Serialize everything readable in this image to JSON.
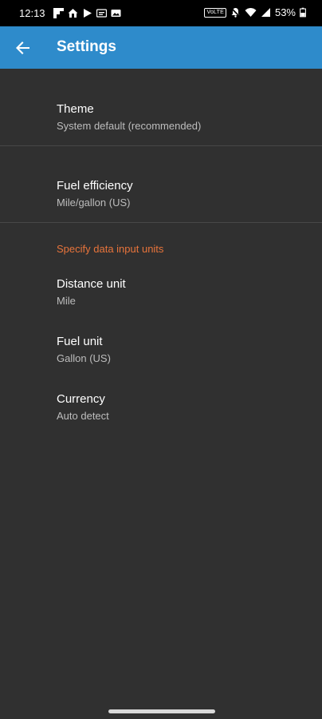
{
  "status_bar": {
    "time": "12:13",
    "left_icons": [
      "flipboard-icon",
      "home-icon",
      "play-icon",
      "tv-icon",
      "gallery-icon"
    ],
    "volte_label": "VoLTE",
    "battery": "53%"
  },
  "app_bar": {
    "title": "Settings",
    "color": "#2e8bcb"
  },
  "preferences": {
    "theme": {
      "title": "Theme",
      "summary": "System default (recommended)"
    },
    "fuel_efficiency": {
      "title": "Fuel efficiency",
      "summary": "Mile/gallon (US)"
    },
    "category_label": "Specify data input units",
    "distance_unit": {
      "title": "Distance unit",
      "summary": "Mile"
    },
    "fuel_unit": {
      "title": "Fuel unit",
      "summary": "Gallon (US)"
    },
    "currency": {
      "title": "Currency",
      "summary": "Auto detect"
    }
  },
  "colors": {
    "background": "#303030",
    "accent": "#e8743b"
  }
}
